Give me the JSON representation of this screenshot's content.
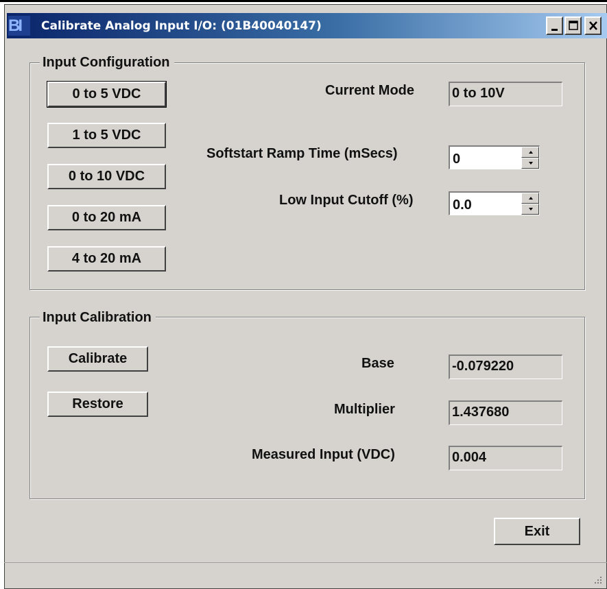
{
  "window": {
    "title": "Calibrate Analog Input I/O: (01B40040147)",
    "icon_text": "BI",
    "controls": [
      "minimize-icon",
      "maximize-icon",
      "close-icon"
    ]
  },
  "input_configuration": {
    "group_label": "Input Configuration",
    "mode_buttons": [
      "0 to 5 VDC",
      "1 to 5 VDC",
      "0 to 10 VDC",
      "0 to 20 mA",
      "4 to 20 mA"
    ],
    "current_mode_label": "Current Mode",
    "current_mode_value": "0 to 10V",
    "softstart_label": "Softstart Ramp Time (mSecs)",
    "softstart_value": "0",
    "low_cutoff_label": "Low Input Cutoff (%)",
    "low_cutoff_value": "0.0"
  },
  "input_calibration": {
    "group_label": "Input Calibration",
    "calibrate_label": "Calibrate",
    "restore_label": "Restore",
    "base_label": "Base",
    "base_value": "-0.079220",
    "multiplier_label": "Multiplier",
    "multiplier_value": "1.437680",
    "measured_label": "Measured Input (VDC)",
    "measured_value": "0.004"
  },
  "footer": {
    "exit_label": "Exit"
  }
}
